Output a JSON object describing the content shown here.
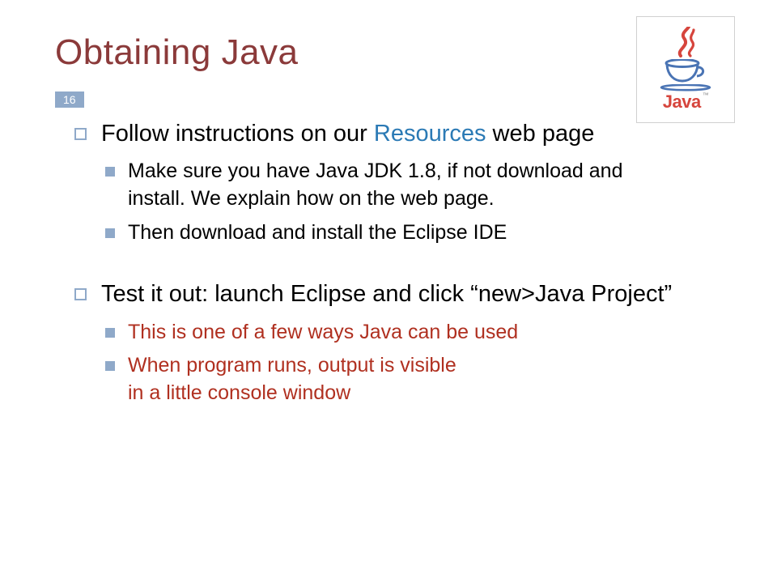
{
  "title": "Obtaining Java",
  "slide_number": "16",
  "logo_text": "Java",
  "bullets": {
    "b1_pre": "Follow instructions on our ",
    "b1_link": "Resources",
    "b1_post": " web page",
    "b1a": "Make sure you have Java JDK 1.8, if not download and install.  We explain how on the web page.",
    "b1b": "Then download and install the Eclipse IDE",
    "b2": "Test it out: launch Eclipse and click “new>Java Project”",
    "b2a": "This is one of a few ways Java can be used",
    "b2b": "When program runs, output is visible in a little console window"
  }
}
